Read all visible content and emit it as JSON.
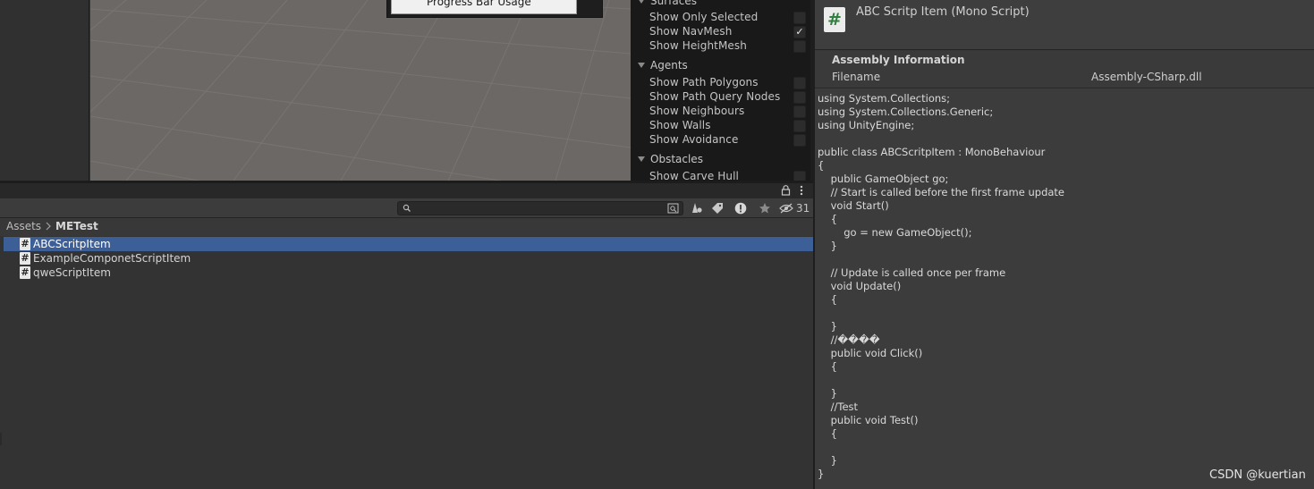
{
  "scene": {
    "context_menu": {
      "item": "Progress Bar Usage"
    }
  },
  "navmesh_panel": {
    "surfaces_header": "Surfaces",
    "surfaces": [
      {
        "label": "Show Only Selected",
        "checked": false
      },
      {
        "label": "Show NavMesh",
        "checked": true
      },
      {
        "label": "Show HeightMesh",
        "checked": false
      }
    ],
    "agents_header": "Agents",
    "agents": [
      {
        "label": "Show Path Polygons",
        "checked": false
      },
      {
        "label": "Show Path Query Nodes",
        "checked": false
      },
      {
        "label": "Show Neighbours",
        "checked": false
      },
      {
        "label": "Show Walls",
        "checked": false
      },
      {
        "label": "Show Avoidance",
        "checked": false
      }
    ],
    "obstacles_header": "Obstacles",
    "obstacles": [
      {
        "label": "Show Carve Hull",
        "checked": false
      }
    ]
  },
  "project": {
    "hidden_count": "31",
    "breadcrumb": {
      "root": "Assets",
      "folder": "METest"
    },
    "assets": [
      {
        "name": "ABCScritpItem",
        "icon": "script-icon",
        "selected": true
      },
      {
        "name": "ExampleComponetScriptItem",
        "icon": "script-icon",
        "selected": false
      },
      {
        "name": "qweScriptItem",
        "icon": "script-icon",
        "selected": false
      }
    ]
  },
  "inspector": {
    "icon_glyph": "#",
    "title": "ABC Scritp Item (Mono Script)",
    "assembly_title": "Assembly Information",
    "filename_label": "Filename",
    "filename_value": "Assembly-CSharp.dll",
    "code": "using System.Collections;\nusing System.Collections.Generic;\nusing UnityEngine;\n\npublic class ABCScritpItem : MonoBehaviour\n{\n    public GameObject go;\n    // Start is called before the first frame update\n    void Start()\n    {\n        go = new GameObject();\n    }\n\n    // Update is called once per frame\n    void Update()\n    {\n\n    }\n    //����\n    public void Click()\n    {\n\n    }\n    //Test\n    public void Test()\n    {\n\n    }\n}"
  },
  "watermark": "CSDN @kuertian",
  "colors": {
    "selection": "#3d5f98",
    "script_icon_hash": "#2f7f3e",
    "scene_ground": "#6c6865"
  }
}
